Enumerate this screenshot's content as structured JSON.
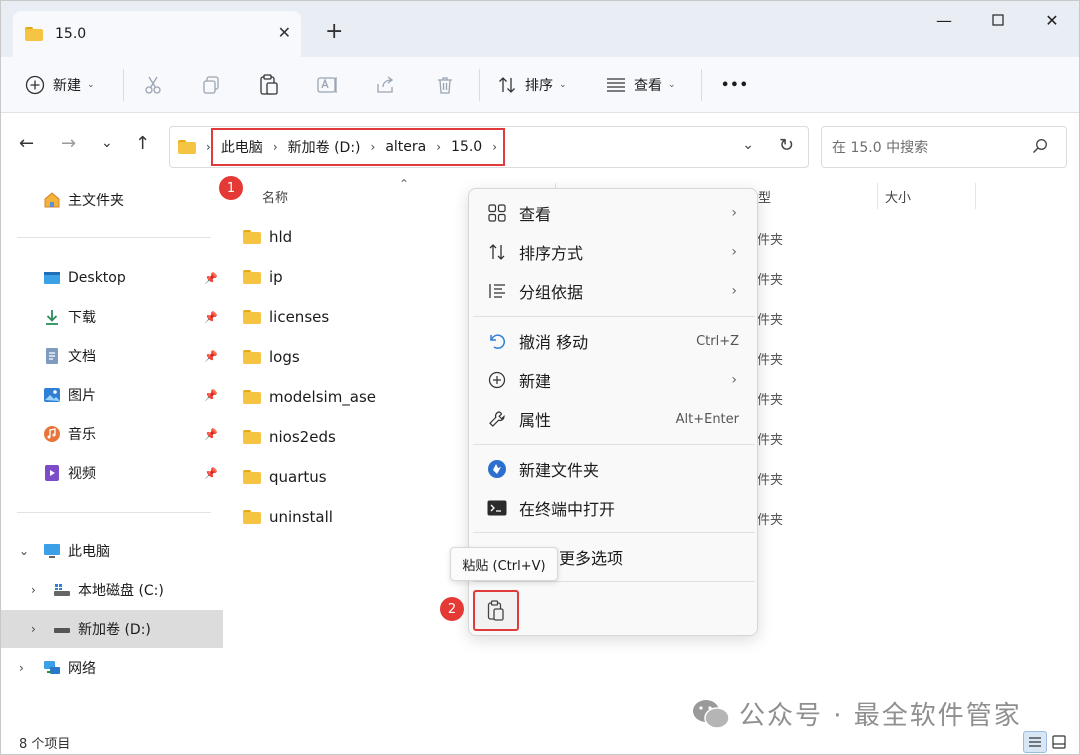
{
  "tab": {
    "title": "15.0"
  },
  "toolbar": {
    "new_label": "新建",
    "sort_label": "排序",
    "view_label": "查看",
    "more_label": "•••"
  },
  "address": {
    "crumbs": [
      "此电脑",
      "新加卷 (D:)",
      "altera",
      "15.0"
    ],
    "search_placeholder": "在 15.0 中搜索"
  },
  "sidebar": {
    "home": "主文件夹",
    "quick": [
      {
        "label": "Desktop",
        "icon": "desktop-icon"
      },
      {
        "label": "下载",
        "icon": "download-icon"
      },
      {
        "label": "文档",
        "icon": "document-icon"
      },
      {
        "label": "图片",
        "icon": "picture-icon"
      },
      {
        "label": "音乐",
        "icon": "music-icon"
      },
      {
        "label": "视频",
        "icon": "video-icon"
      }
    ],
    "this_pc": "此电脑",
    "drives": [
      "本地磁盘 (C:)",
      "新加卷 (D:)"
    ],
    "network": "网络"
  },
  "columns": {
    "name": "名称",
    "type_frag": "型",
    "size": "大小"
  },
  "files": [
    {
      "name": "hld",
      "type": "件夹"
    },
    {
      "name": "ip",
      "type": "件夹"
    },
    {
      "name": "licenses",
      "type": "件夹"
    },
    {
      "name": "logs",
      "type": "件夹"
    },
    {
      "name": "modelsim_ase",
      "type": "件夹"
    },
    {
      "name": "nios2eds",
      "type": "件夹"
    },
    {
      "name": "quartus",
      "type": "件夹"
    },
    {
      "name": "uninstall",
      "type": "件夹"
    }
  ],
  "context_menu": {
    "view": "查看",
    "sort": "排序方式",
    "group": "分组依据",
    "undo": "撤消 移动",
    "undo_shortcut": "Ctrl+Z",
    "new": "新建",
    "properties": "属性",
    "properties_shortcut": "Alt+Enter",
    "new_folder": "新建文件夹",
    "open_terminal": "在终端中打开",
    "more_options": "更多选项",
    "paste_tooltip": "粘贴 (Ctrl+V)"
  },
  "annotations": {
    "badge1": "1",
    "badge2": "2"
  },
  "status": {
    "count": "8 个项目"
  },
  "watermark": "公众号 · 最全软件管家",
  "colors": {
    "highlight": "#e03a3a",
    "folder": "#f6c443",
    "badge": "#e53935"
  }
}
